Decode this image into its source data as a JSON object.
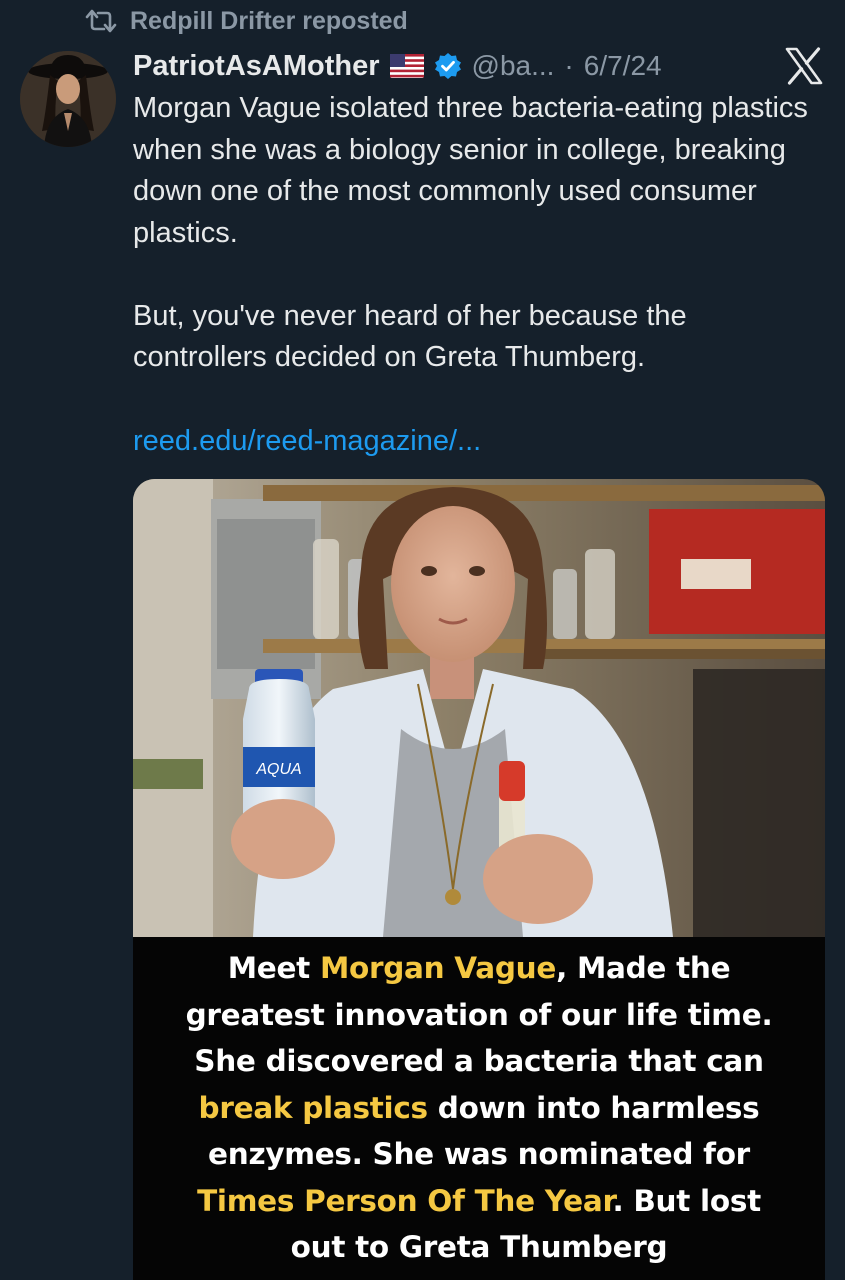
{
  "repost": {
    "text": "Redpill Drifter reposted",
    "icon": "repost-icon"
  },
  "author": {
    "name": "PatriotAsAMother",
    "flag_icon": "us-flag-icon",
    "verified_icon": "verified-badge-icon",
    "handle": "@ba...",
    "separator": "·",
    "date": "6/7/24",
    "avatar": "avatar-woman-cowboy-hat"
  },
  "platform_icon": "x-logo-icon",
  "tweet": {
    "paragraph1": "Morgan Vague isolated three bacteria-eating plastics when she was a biology senior in college, breaking down one of the most commonly used consumer plastics.",
    "paragraph2": "But, you've never heard of her because the controllers decided on Greta Thumberg.",
    "link": "reed.edu/reed-magazine/..."
  },
  "media": {
    "bottle_label": "AQUA",
    "caption": {
      "l1a": "Meet ",
      "l1b": "Morgan Vague",
      "l1c": ", Made the",
      "l2": "greatest innovation of our life time.",
      "l3": "She discovered a bacteria that can",
      "l4a": "break plastics",
      "l4b": " down into harmless",
      "l5": "enzymes. She was nominated for",
      "l6a": "Times Person Of The Year",
      "l6b": ". But lost",
      "l7": "out to Greta Thumberg"
    }
  },
  "colors": {
    "background": "#15202b",
    "link": "#1d9bf0",
    "muted": "#8b98a5",
    "caption_highlight": "#f5c842"
  }
}
